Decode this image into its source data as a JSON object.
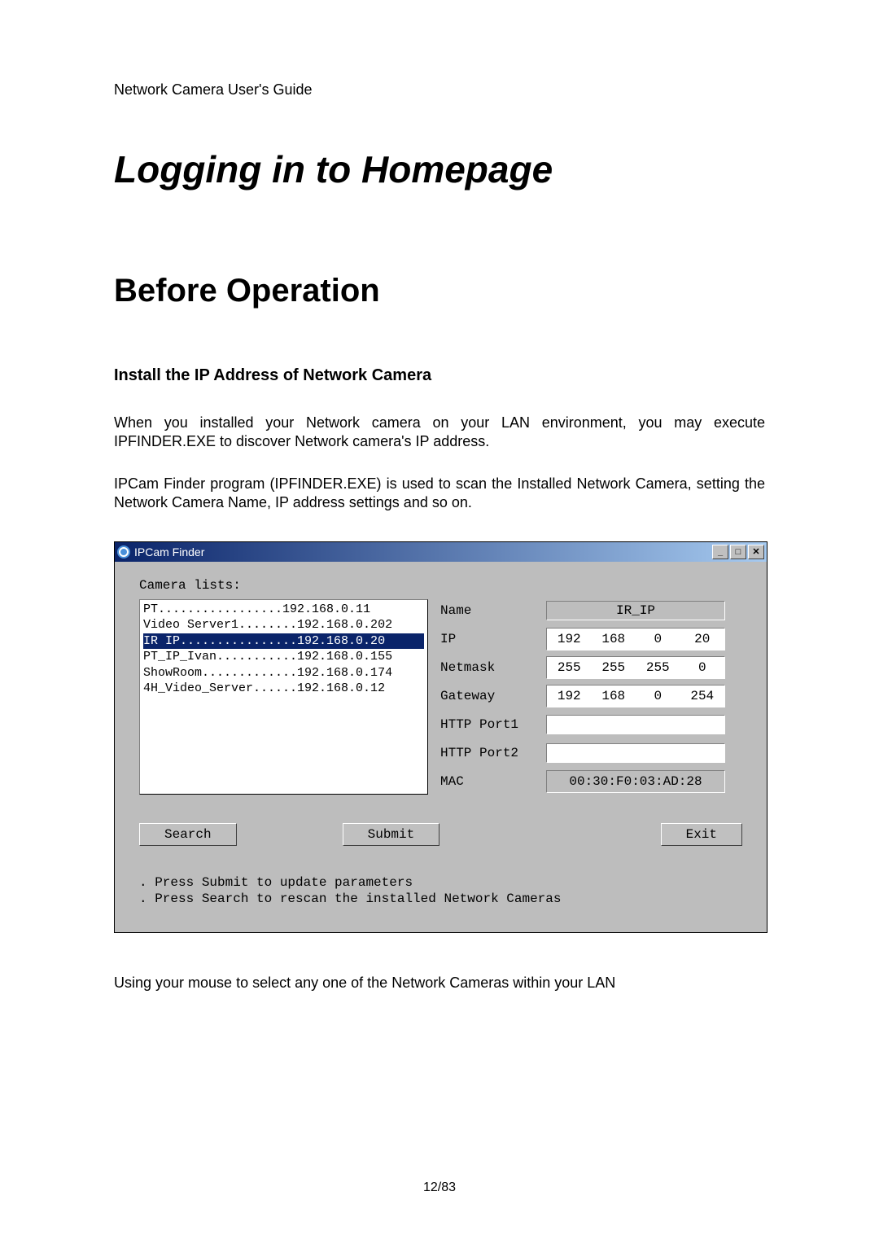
{
  "header": "Network Camera User's Guide",
  "main_title": "Logging in to Homepage",
  "section_title": "Before Operation",
  "subsection_title": "Install the IP Address of Network Camera",
  "para1": "When you installed your Network camera on your LAN environment, you may execute IPFINDER.EXE to discover Network camera's IP address.",
  "para2": "IPCam Finder program (IPFINDER.EXE) is used to scan the Installed Network Camera, setting the Network Camera Name, IP address settings and so on.",
  "para3": "Using your mouse to select any one of the Network Cameras within your LAN",
  "page_number": "12/83",
  "app": {
    "title": "IPCam Finder",
    "camera_lists_label": "Camera lists:",
    "items": [
      {
        "name": "PT",
        "dots": ".................",
        "ip": "192.168.0.11",
        "selected": false
      },
      {
        "name": "Video Server1",
        "dots": "........",
        "ip": "192.168.0.202",
        "selected": false
      },
      {
        "name": "IR IP",
        "dots": "................",
        "ip": "192.168.0.20",
        "selected": true
      },
      {
        "name": "PT_IP_Ivan",
        "dots": "...........",
        "ip": "192.168.0.155",
        "selected": false
      },
      {
        "name": "ShowRoom",
        "dots": ".............",
        "ip": "192.168.0.174",
        "selected": false
      },
      {
        "name": "4H_Video_Server",
        "dots": "......",
        "ip": "192.168.0.12",
        "selected": false
      }
    ],
    "fields": {
      "name_label": "Name",
      "name_value": "IR_IP",
      "ip_label": "IP",
      "ip": [
        "192",
        "168",
        "0",
        "20"
      ],
      "netmask_label": "Netmask",
      "netmask": [
        "255",
        "255",
        "255",
        "0"
      ],
      "gateway_label": "Gateway",
      "gateway": [
        "192",
        "168",
        "0",
        "254"
      ],
      "http_port1_label": "HTTP Port1",
      "http_port2_label": "HTTP Port2",
      "mac_label": "MAC",
      "mac_value": "00:30:F0:03:AD:28"
    },
    "buttons": {
      "search": "Search",
      "submit": "Submit",
      "exit": "Exit"
    },
    "hints": [
      ". Press Submit to update parameters",
      ". Press Search to rescan the installed Network Cameras"
    ]
  }
}
